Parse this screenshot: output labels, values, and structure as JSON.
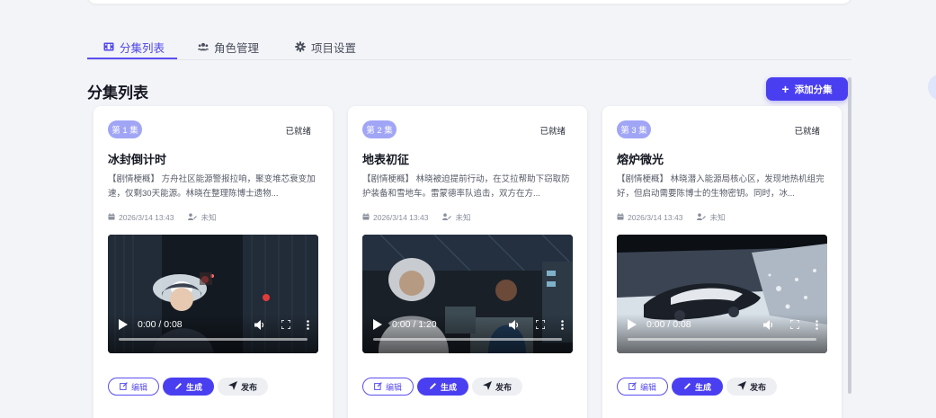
{
  "tabs": [
    {
      "label": "分集列表",
      "icon": "film-icon",
      "active": true
    },
    {
      "label": "角色管理",
      "icon": "users-icon",
      "active": false
    },
    {
      "label": "项目设置",
      "icon": "gear-icon",
      "active": false
    }
  ],
  "section": {
    "title": "分集列表"
  },
  "add_button": {
    "label": "添加分集",
    "icon": "+"
  },
  "accent_color": "#4a3ff0",
  "episodes": [
    {
      "badge": "第 1 集",
      "status": "已就绪",
      "title": "冰封倒计时",
      "description": "【剧情梗概】 方舟社区能源警报拉响，聚变堆芯衰变加速，仅剩30天能源。林晓在整理陈博士遗物...",
      "date": "2026/3/14 13:43",
      "author": "未知",
      "video_time": "0:00 / 0:08",
      "buttons": {
        "edit": "编辑",
        "generate": "生成",
        "publish": "发布"
      }
    },
    {
      "badge": "第 2 集",
      "status": "已就绪",
      "title": "地表初征",
      "description": "【剧情梗概】 林晓被迫提前行动，在艾拉帮助下窃取防护装备和雪地车。雷蒙德率队追击，双方在方...",
      "date": "2026/3/14 13:43",
      "author": "未知",
      "video_time": "0:00 / 1:20",
      "buttons": {
        "edit": "编辑",
        "generate": "生成",
        "publish": "发布"
      }
    },
    {
      "badge": "第 3 集",
      "status": "已就绪",
      "title": "熔炉微光",
      "description": "【剧情梗概】 林晓潜入能源局核心区，发现地热机组完好，但启动需要陈博士的生物密钥。同时，冰...",
      "date": "2026/3/14 13:43",
      "author": "未知",
      "video_time": "0:00 / 0:08",
      "buttons": {
        "edit": "编辑",
        "generate": "生成",
        "publish": "发布"
      }
    }
  ]
}
